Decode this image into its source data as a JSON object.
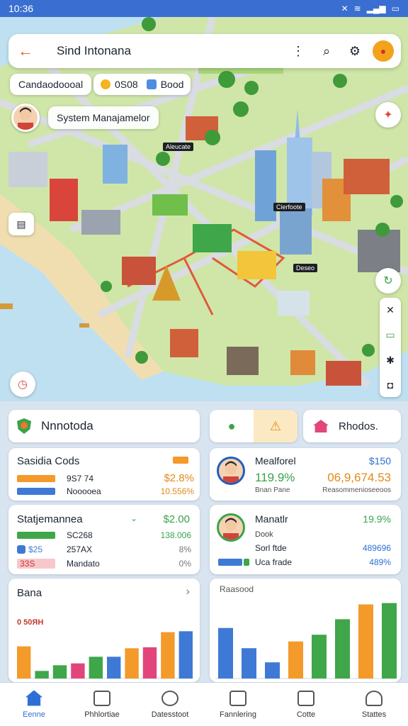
{
  "status_bar": {
    "time": "10:36",
    "icons": [
      "mute-icon",
      "wifi-icon",
      "signal-icon",
      "battery-icon"
    ]
  },
  "topbar": {
    "title": "Sind Intonana",
    "icons": [
      "more-icon",
      "search-icon",
      "settings-icon",
      "location-pin-icon"
    ]
  },
  "chips": {
    "category": "Candaodoooal",
    "count": "0S08",
    "mode": "Bood"
  },
  "user_chip": {
    "label": "System Manajamelor"
  },
  "map_labels": [
    "Aleucate",
    "Cierfoote",
    "Deseo"
  ],
  "panel": {
    "title_card": {
      "label": "Nnnotoda"
    },
    "photos_card": {
      "label": "Rhodos."
    },
    "sales": {
      "title": "Sasidia Cods",
      "rows": [
        {
          "label": "9S7 74",
          "value": "$2.8%",
          "color": "#f39a2a"
        },
        {
          "label": "Nooooea",
          "value": "10.556%",
          "color": "#3f79d6"
        }
      ]
    },
    "statement": {
      "title": "Statjemannea",
      "value": "$2.00",
      "rows": [
        {
          "label": "SC268",
          "value": "138.006",
          "prefix": "",
          "color": "#3fa64a"
        },
        {
          "label": "257AX",
          "value": "8%",
          "prefix": "$25",
          "color": "#3f79d6"
        },
        {
          "label": "Mandato",
          "value": "0%",
          "prefix": "33S",
          "color": "#e96a76"
        }
      ]
    },
    "bana": {
      "title": "Bana",
      "tag": "0 50ЯН"
    },
    "profile_1": {
      "name": "Mealforel",
      "amount": "$150",
      "stat_a": "119.9%",
      "stat_b": "06,9,674.53",
      "sub_a": "Bnan Pane",
      "sub_b": "Reasommenioseeoos"
    },
    "profile_2": {
      "name": "Manatlr",
      "pct": "19.9%",
      "line1": "Dook",
      "line2": "Sorl ftde",
      "line3": "Uca frade",
      "val1": "489696",
      "val2": "489%"
    },
    "chart2": {
      "title": "Raasood"
    }
  },
  "chart_data": [
    {
      "type": "bar",
      "title": "Bana",
      "series": [
        {
          "values": [
            34,
            8,
            14,
            16,
            23,
            23,
            32,
            33,
            49,
            50
          ]
        }
      ],
      "colors": [
        "#f39a2a",
        "#3fa64a",
        "#3fa64a",
        "#e2457b",
        "#3fa64a",
        "#3f79d6",
        "#f39a2a",
        "#e2457b",
        "#f39a2a",
        "#3f79d6"
      ],
      "ylim": [
        0,
        60
      ]
    },
    {
      "type": "bar",
      "title": "Raasood",
      "series": [
        {
          "values": [
            75,
            45,
            24,
            55,
            65,
            88,
            110,
            112
          ]
        }
      ],
      "colors": [
        "#3f79d6",
        "#3f79d6",
        "#3f79d6",
        "#f39a2a",
        "#3fa64a",
        "#3fa64a",
        "#f39a2a",
        "#3fa64a"
      ],
      "ylim": [
        0,
        120
      ]
    }
  ],
  "nav": [
    {
      "label": "Eenne",
      "icon": "home-icon"
    },
    {
      "label": "Phhlortiae",
      "icon": "chat-icon"
    },
    {
      "label": "Datesstoot",
      "icon": "globe-icon"
    },
    {
      "label": "Fannlering",
      "icon": "document-icon"
    },
    {
      "label": "Cotte",
      "icon": "message-icon"
    },
    {
      "label": "Stattes",
      "icon": "user-icon"
    }
  ]
}
